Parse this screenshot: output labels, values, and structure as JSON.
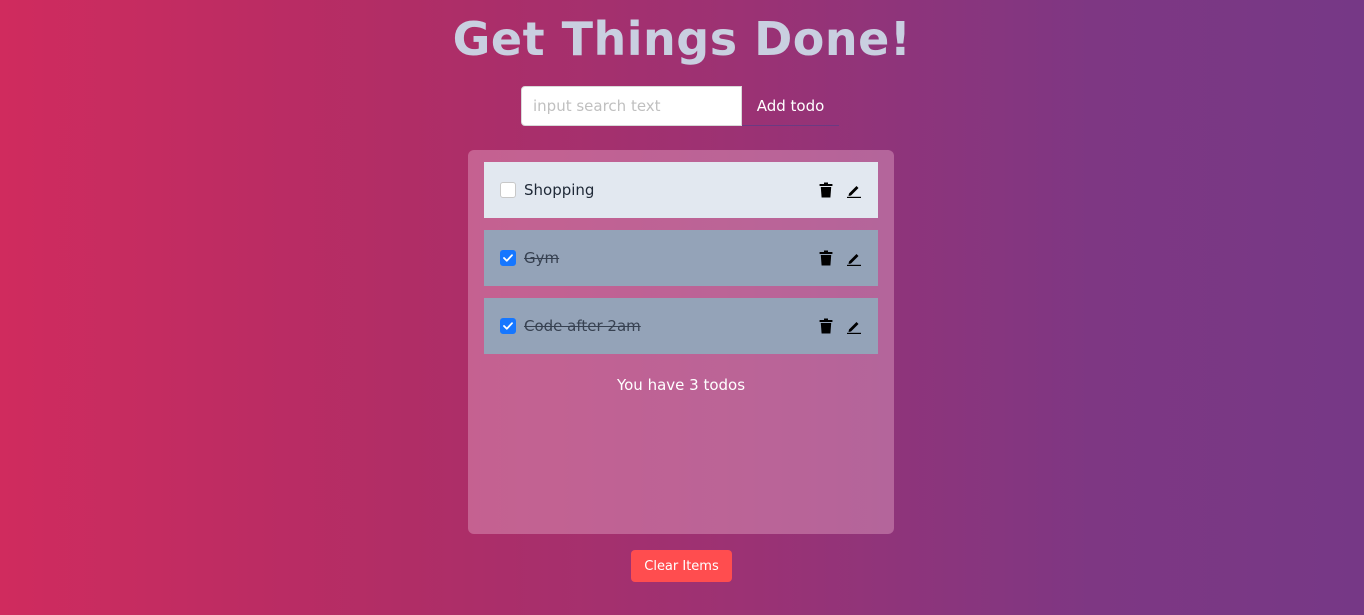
{
  "header": {
    "title": "Get Things Done!"
  },
  "form": {
    "placeholder": "input search text",
    "value": "",
    "add_label": "Add todo"
  },
  "todos": [
    {
      "label": "Shopping",
      "completed": false,
      "delete_icon": "trash-icon",
      "edit_icon": "pencil-icon"
    },
    {
      "label": "Gym",
      "completed": true,
      "delete_icon": "trash-icon",
      "edit_icon": "pencil-icon"
    },
    {
      "label": "Code after 2am",
      "completed": true,
      "delete_icon": "trash-icon",
      "edit_icon": "pencil-icon"
    }
  ],
  "summary": {
    "count_text": "You have 3 todos"
  },
  "footer": {
    "clear_label": "Clear Items"
  },
  "colors": {
    "title": "#c9cfe0",
    "todo_open_bg": "#e2e8f0",
    "todo_done_bg": "#94a3b8",
    "checkbox_checked": "#1677ff",
    "clear_button": "#ff4d4f"
  }
}
